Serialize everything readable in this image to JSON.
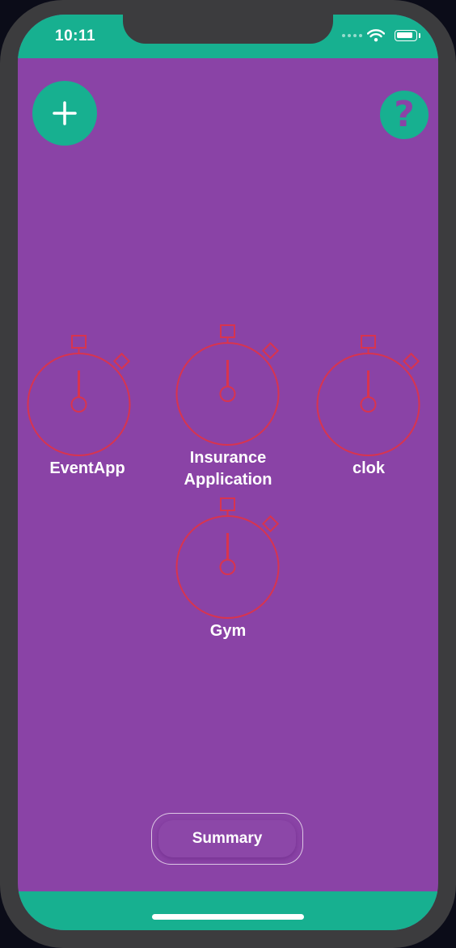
{
  "status_bar": {
    "time": "10:11",
    "icons": [
      "signal-dots-icon",
      "wifi-icon",
      "battery-icon"
    ],
    "battery_level": 0.9
  },
  "header": {
    "add_icon": "plus-icon",
    "help_icon": "question-mark-icon",
    "help_glyph": "?"
  },
  "timers": [
    {
      "label": "EventApp"
    },
    {
      "label": "Insurance Application"
    },
    {
      "label": "clok"
    },
    {
      "label": "Gym"
    }
  ],
  "timer_icon": "stopwatch-icon",
  "summary_button": {
    "label": "Summary"
  },
  "colors": {
    "accent": "#17b090",
    "background": "#8a43a6",
    "stopwatch_stroke": "#d8344f",
    "text": "#ffffff"
  }
}
